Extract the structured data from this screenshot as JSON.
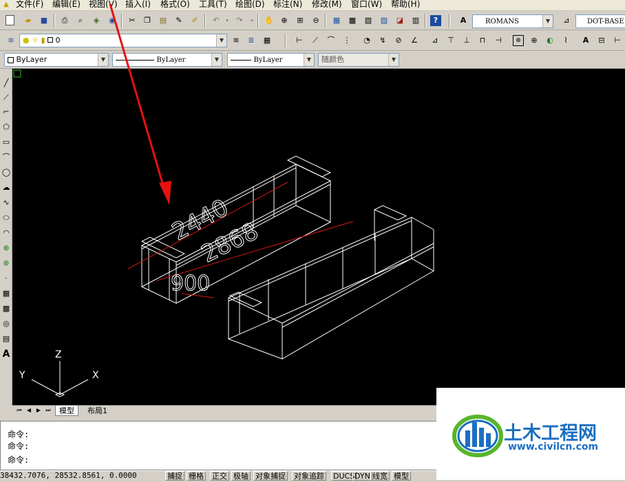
{
  "menubar": {
    "items": [
      {
        "label": "文件(F)"
      },
      {
        "label": "编辑(E)"
      },
      {
        "label": "视图(V)"
      },
      {
        "label": "插入(I)"
      },
      {
        "label": "格式(O)"
      },
      {
        "label": "工具(T)"
      },
      {
        "label": "绘图(D)"
      },
      {
        "label": "标注(N)"
      },
      {
        "label": "修改(M)"
      },
      {
        "label": "窗口(W)"
      },
      {
        "label": "帮助(H)"
      }
    ]
  },
  "toolbar1": {
    "text_style": "ROMANS",
    "dim_style": "DOT-BASE"
  },
  "toolbar2": {
    "layer_name": "0"
  },
  "properties": {
    "color": "ByLayer",
    "linetype": "ByLayer",
    "lineweight": "ByLayer",
    "plot_style": "随颜色"
  },
  "drawing": {
    "dim_text_top": "2440",
    "dim_text_mid": "2868",
    "dim_text_bottom": "900",
    "annotation_arrow_color": "#e81010",
    "dim_line_color": "#d01818",
    "wire_color": "#ffffff",
    "ucs": {
      "z_label": "Z",
      "y_label": "Y",
      "x_label": "X"
    }
  },
  "layout_tabs": {
    "model": "模型",
    "layout1": "布局1"
  },
  "command": {
    "lines": [
      "命令:",
      "命令:",
      "命令:"
    ]
  },
  "status": {
    "coords": "38432.7076, 28532.8561, 0.0000",
    "buttons": [
      "捕捉",
      "栅格",
      "正交",
      "极轴",
      "对象捕捉",
      "对象追踪",
      "DUCS",
      "DYN",
      "线宽",
      "模型"
    ]
  },
  "watermark": {
    "name": "土木工程网",
    "url": "www.civilcn.com",
    "brand_blue": "#1b6fc2",
    "brand_green": "#58b52c"
  }
}
